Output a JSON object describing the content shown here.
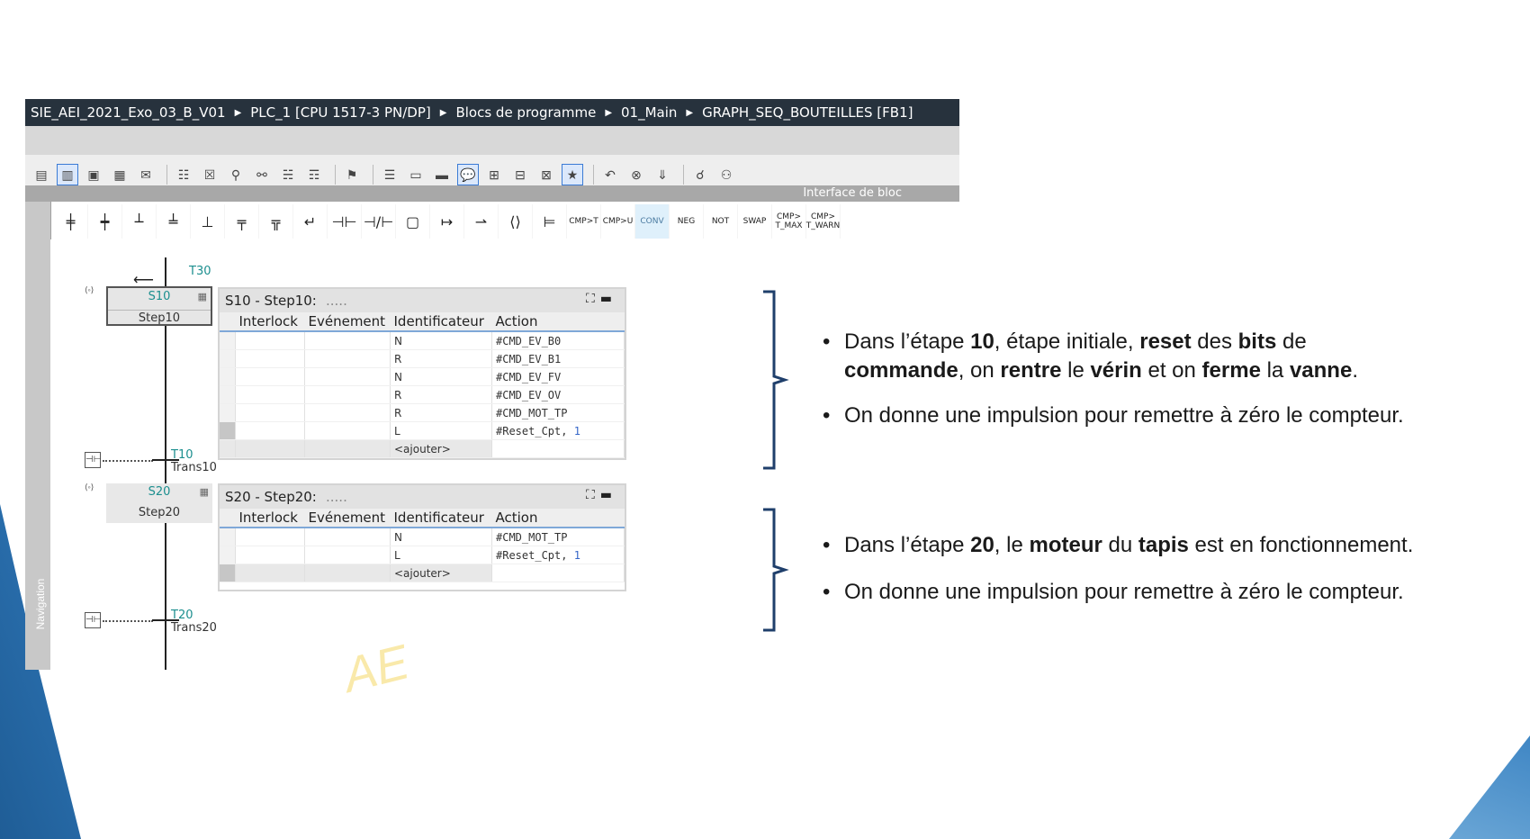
{
  "breadcrumb": {
    "items": [
      "SIE_AEI_2021_Exo_03_B_V01",
      "PLC_1 [CPU 1517-3 PN/DP]",
      "Blocs de programme",
      "01_Main",
      "GRAPH_SEQ_BOUTEILLES [FB1]"
    ]
  },
  "interface_bar": {
    "label": "Interface de bloc"
  },
  "navigation": {
    "label": "Navigation"
  },
  "toolbar2": {
    "text_buttons": [
      "CMP>T",
      "CMP>U",
      "CONV",
      "NEG",
      "NOT",
      "SWAP",
      "CMP> T_MAX",
      "CMP> T_WARN"
    ]
  },
  "graph": {
    "t30": {
      "label": "T30"
    },
    "s10": {
      "num": "S10",
      "name": "Step10"
    },
    "t10": {
      "label": "T10",
      "name": "Trans10"
    },
    "s20": {
      "num": "S20",
      "name": "Step20"
    },
    "t20": {
      "label": "T20",
      "name": "Trans20"
    }
  },
  "panel1": {
    "title": "S10 - Step10:",
    "dots": ".....",
    "headers": [
      "Interlock",
      "Evénement",
      "Identificateur",
      "Action"
    ],
    "rows": [
      {
        "id": "N",
        "action": "#CMD_EV_B0",
        "extra": ""
      },
      {
        "id": "R",
        "action": "#CMD_EV_B1",
        "extra": ""
      },
      {
        "id": "N",
        "action": "#CMD_EV_FV",
        "extra": ""
      },
      {
        "id": "R",
        "action": "#CMD_EV_OV",
        "extra": ""
      },
      {
        "id": "R",
        "action": "#CMD_MOT_TP",
        "extra": ""
      },
      {
        "id": "L",
        "action": "#Reset_Cpt,",
        "extra": "1"
      }
    ],
    "add": "<ajouter>"
  },
  "panel2": {
    "title": "S20 - Step20:",
    "dots": ".....",
    "headers": [
      "Interlock",
      "Evénement",
      "Identificateur",
      "Action"
    ],
    "rows": [
      {
        "id": "N",
        "action": "#CMD_MOT_TP",
        "extra": ""
      },
      {
        "id": "L",
        "action": "#Reset_Cpt,",
        "extra": "1"
      }
    ],
    "add": "<ajouter>"
  },
  "watermark": {
    "text": "AE"
  },
  "notes1": {
    "b1": {
      "t1": "Dans l’étape ",
      "b1": "10",
      "t2": ", étape initiale, ",
      "b2": "reset",
      "t3": " des ",
      "b3": "bits",
      "t4": " de ",
      "b4": "commande",
      "t5": ", on ",
      "b5": "rentre",
      "t6": " le ",
      "b6": "vérin",
      "t7": " et on ",
      "b7": "ferme",
      "t8": " la ",
      "b8": "vanne",
      "t9": "."
    },
    "b2": "On donne une impulsion pour remettre à zéro le compteur."
  },
  "notes2": {
    "b1": {
      "t1": "Dans l’étape ",
      "b1": "20",
      "t2": ", le ",
      "b2": "moteur",
      "t3": " du ",
      "b3": "tapis",
      "t4": " est en fonctionnement."
    },
    "b2": "On donne une impulsion pour remettre à zéro le compteur."
  },
  "colors": {
    "breadcrumb_bg": "#27323d",
    "step_label": "#1c8f8f",
    "brace": "#1f3f6b",
    "slide_accent": "#2a6aa8"
  }
}
